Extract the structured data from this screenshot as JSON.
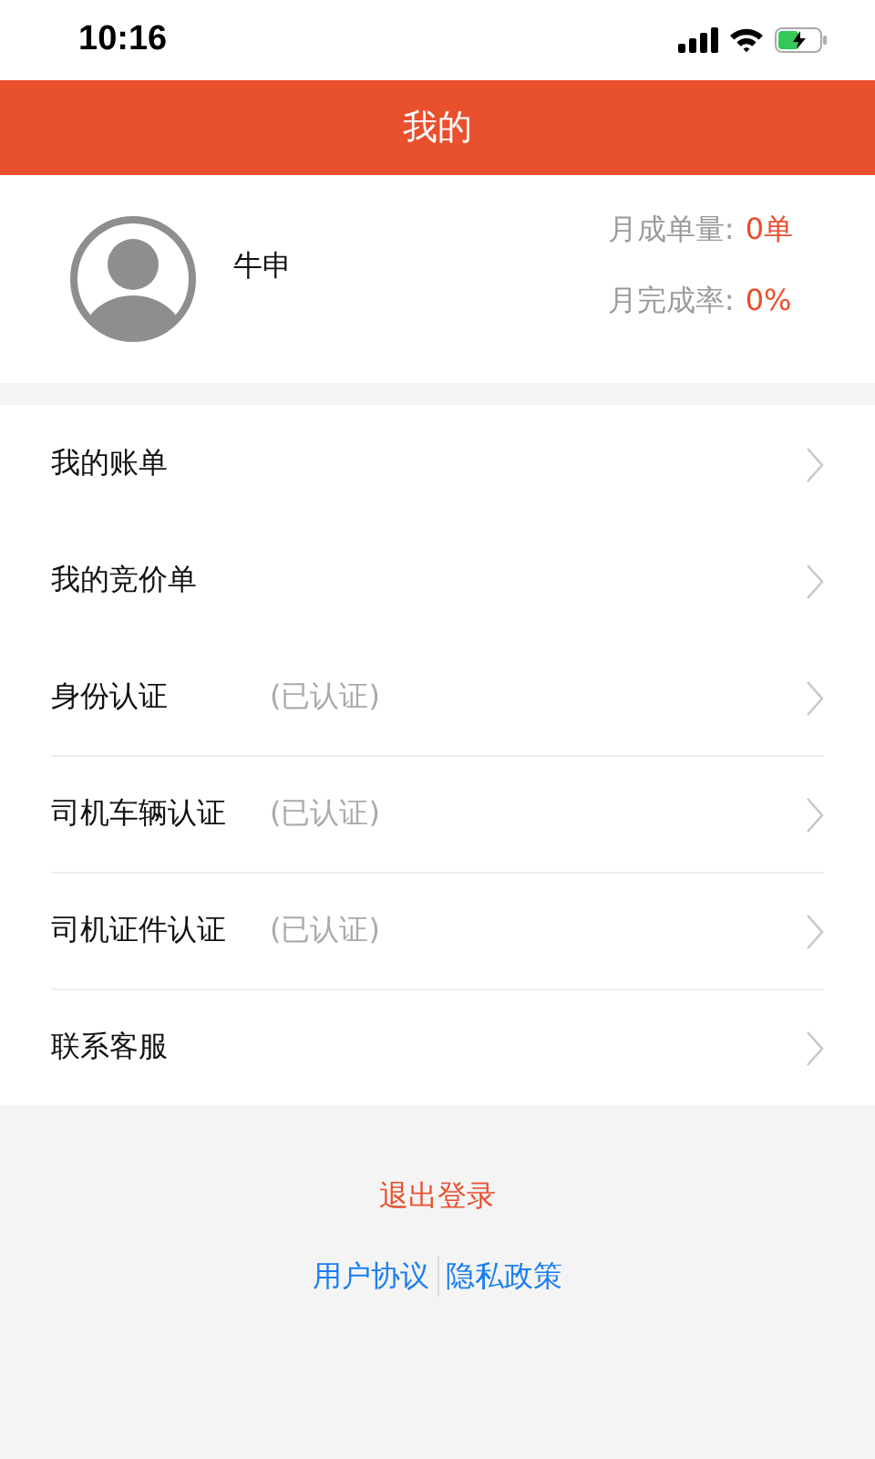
{
  "status_bar": {
    "time": "10:16"
  },
  "header": {
    "title": "我的"
  },
  "profile": {
    "name": "牛申",
    "stats": [
      {
        "label": "月成单量:",
        "value": "0单"
      },
      {
        "label": "月完成率:",
        "value": "0%"
      }
    ]
  },
  "menu": [
    {
      "label": "我的账单",
      "divider_above": false
    },
    {
      "label": "我的竞价单",
      "divider_above": false
    },
    {
      "label": "身份认证",
      "status": "(已认证)",
      "divider_above": false
    },
    {
      "label": "司机车辆认证",
      "status": "(已认证)",
      "divider_above": true
    },
    {
      "label": "司机证件认证",
      "status": "(已认证)",
      "divider_above": true
    },
    {
      "label": "联系客服",
      "divider_above": true
    }
  ],
  "logout": "退出登录",
  "links": [
    "用户协议",
    "隐私政策"
  ]
}
